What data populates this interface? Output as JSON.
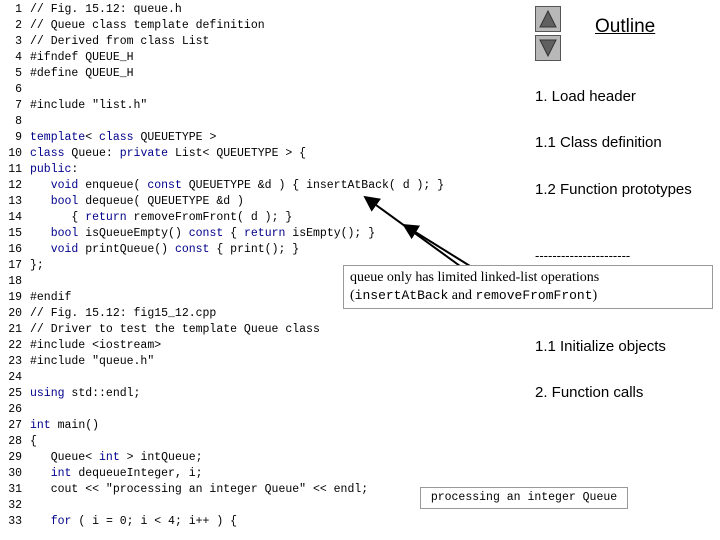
{
  "code_lines": [
    {
      "n": "1",
      "t": "// Fig. 15.12: queue.h"
    },
    {
      "n": "2",
      "t": "// Queue class template definition"
    },
    {
      "n": "3",
      "t": "// Derived from class List"
    },
    {
      "n": "4",
      "t": "#ifndef QUEUE_H"
    },
    {
      "n": "5",
      "t": "#define QUEUE_H"
    },
    {
      "n": "6",
      "t": ""
    },
    {
      "n": "7",
      "t": "#include \"list.h\""
    },
    {
      "n": "8",
      "t": ""
    },
    {
      "n": "9",
      "t": "template< class QUEUETYPE >"
    },
    {
      "n": "10",
      "t": "class Queue: private List< QUEUETYPE > {"
    },
    {
      "n": "11",
      "t": "public:"
    },
    {
      "n": "12",
      "t": "   void enqueue( const QUEUETYPE &d ) { insertAtBack( d ); }"
    },
    {
      "n": "13",
      "t": "   bool dequeue( QUEUETYPE &d )"
    },
    {
      "n": "14",
      "t": "      { return removeFromFront( d ); }"
    },
    {
      "n": "15",
      "t": "   bool isQueueEmpty() const { return isEmpty(); }"
    },
    {
      "n": "16",
      "t": "   void printQueue() const { print(); }"
    },
    {
      "n": "17",
      "t": "};"
    },
    {
      "n": "18",
      "t": ""
    },
    {
      "n": "19",
      "t": "#endif"
    },
    {
      "n": "20",
      "t": "// Fig. 15.12: fig15_12.cpp"
    },
    {
      "n": "21",
      "t": "// Driver to test the template Queue class"
    },
    {
      "n": "22",
      "t": "#include <iostream>"
    },
    {
      "n": "23",
      "t": "#include \"queue.h\""
    },
    {
      "n": "24",
      "t": ""
    },
    {
      "n": "25",
      "t": "using std::endl;"
    },
    {
      "n": "26",
      "t": ""
    },
    {
      "n": "27",
      "t": "int main()"
    },
    {
      "n": "28",
      "t": "{"
    },
    {
      "n": "29",
      "t": "   Queue< int > intQueue;"
    },
    {
      "n": "30",
      "t": "   int dequeueInteger, i;"
    },
    {
      "n": "31",
      "t": "   cout << \"processing an integer Queue\" << endl;"
    },
    {
      "n": "32",
      "t": ""
    },
    {
      "n": "33",
      "t": "   for ( i = 0; i < 4; i++ ) {"
    }
  ],
  "outline": {
    "title": "Outline",
    "items": [
      "1. Load header",
      "1.1 Class definition",
      "1.2 Function prototypes",
      "----------------------",
      "1.1 Initialize objects",
      "2. Function calls"
    ]
  },
  "callout_limited": {
    "line1": "queue only has limited linked-list operations",
    "open": "(",
    "m1": "insertAtBack",
    "and": " and ",
    "m2": "removeFromFront",
    "close": ")"
  },
  "callout_output": {
    "text": "processing an integer Queue"
  },
  "colors": {
    "keyword": "#00008b",
    "nav_button": "#b8b8b8"
  }
}
